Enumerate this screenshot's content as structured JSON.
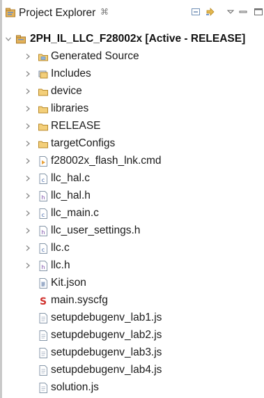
{
  "view": {
    "title": "Project Explorer",
    "close_glyph": "⌘"
  },
  "toolbar": {
    "collapse_icon": "collapse-all-icon",
    "link_icon": "link-with-editor-icon",
    "view_menu_icon": "view-menu-icon",
    "minimize_icon": "minimize-icon",
    "maximize_icon": "maximize-icon"
  },
  "project": {
    "name": "2PH_IL_LLC_F28002x",
    "status": "[Active - RELEASE]",
    "icon": "project-folder-icon"
  },
  "items": [
    {
      "label": "Generated Source",
      "icon": "source-folder-icon",
      "expandable": true
    },
    {
      "label": "Includes",
      "icon": "includes-icon",
      "expandable": true
    },
    {
      "label": "device",
      "icon": "folder-icon",
      "expandable": true
    },
    {
      "label": "libraries",
      "icon": "folder-icon",
      "expandable": true
    },
    {
      "label": "RELEASE",
      "icon": "folder-icon",
      "expandable": true
    },
    {
      "label": "targetConfigs",
      "icon": "folder-icon",
      "expandable": true
    },
    {
      "label": "f28002x_flash_lnk.cmd",
      "icon": "cmd-file-icon",
      "expandable": true
    },
    {
      "label": "llc_hal.c",
      "icon": "c-file-icon",
      "expandable": true
    },
    {
      "label": "llc_hal.h",
      "icon": "h-file-icon",
      "expandable": true
    },
    {
      "label": "llc_main.c",
      "icon": "c-file-icon",
      "expandable": true
    },
    {
      "label": "llc_user_settings.h",
      "icon": "h-file-icon",
      "expandable": true
    },
    {
      "label": "llc.c",
      "icon": "c-file-icon",
      "expandable": true
    },
    {
      "label": "llc.h",
      "icon": "h-file-icon",
      "expandable": true
    },
    {
      "label": "Kit.json",
      "icon": "json-file-icon",
      "expandable": false
    },
    {
      "label": "main.syscfg",
      "icon": "syscfg-file-icon",
      "expandable": false
    },
    {
      "label": "setupdebugenv_lab1.js",
      "icon": "js-file-icon",
      "expandable": false
    },
    {
      "label": "setupdebugenv_lab2.js",
      "icon": "js-file-icon",
      "expandable": false
    },
    {
      "label": "setupdebugenv_lab3.js",
      "icon": "js-file-icon",
      "expandable": false
    },
    {
      "label": "setupdebugenv_lab4.js",
      "icon": "js-file-icon",
      "expandable": false
    },
    {
      "label": "solution.js",
      "icon": "js-file-icon",
      "expandable": false
    }
  ],
  "colors": {
    "folder": "#e3b25a",
    "chevron": "#8a8a8a",
    "file_border": "#8596a8",
    "syscfg_red": "#d0312d"
  }
}
